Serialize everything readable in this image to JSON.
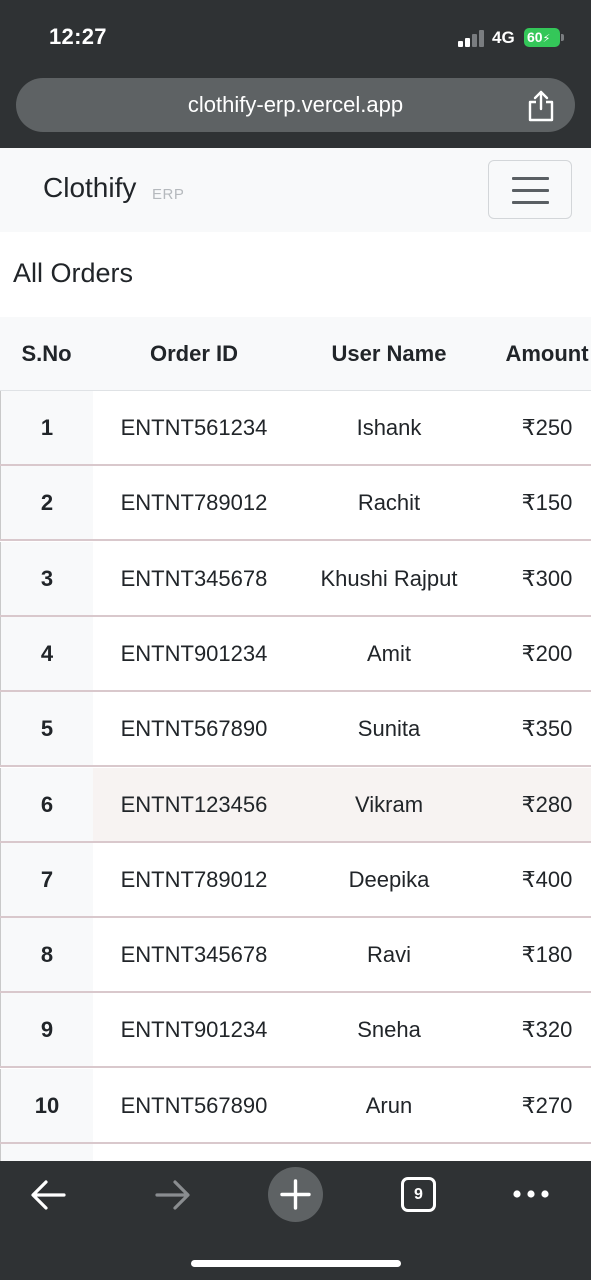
{
  "status_bar": {
    "time": "12:27",
    "network": "4G",
    "battery": "60",
    "icons": [
      "signal-icon",
      "battery-charging-icon"
    ]
  },
  "browser": {
    "url": "clothify-erp.vercel.app",
    "tab_count": "9",
    "icons": [
      "share-icon",
      "back-arrow-icon",
      "forward-arrow-icon",
      "plus-icon",
      "tabs-icon",
      "more-dots-icon"
    ]
  },
  "navbar": {
    "brand": "Clothify",
    "brand_sub": "ERP",
    "toggler_icon": "hamburger-menu-icon"
  },
  "page": {
    "title": "All Orders"
  },
  "table": {
    "headers": {
      "sno": "S.No",
      "order_id": "Order ID",
      "user_name": "User Name",
      "amount": "Amount"
    },
    "rows": [
      {
        "sno": "1",
        "order_id": "ENTNT561234",
        "user_name": "Ishank",
        "amount": "₹250"
      },
      {
        "sno": "2",
        "order_id": "ENTNT789012",
        "user_name": "Rachit",
        "amount": "₹150"
      },
      {
        "sno": "3",
        "order_id": "ENTNT345678",
        "user_name": "Khushi Rajput",
        "amount": "₹300"
      },
      {
        "sno": "4",
        "order_id": "ENTNT901234",
        "user_name": "Amit",
        "amount": "₹200"
      },
      {
        "sno": "5",
        "order_id": "ENTNT567890",
        "user_name": "Sunita",
        "amount": "₹350"
      },
      {
        "sno": "6",
        "order_id": "ENTNT123456",
        "user_name": "Vikram",
        "amount": "₹280"
      },
      {
        "sno": "7",
        "order_id": "ENTNT789012",
        "user_name": "Deepika",
        "amount": "₹400"
      },
      {
        "sno": "8",
        "order_id": "ENTNT345678",
        "user_name": "Ravi",
        "amount": "₹180"
      },
      {
        "sno": "9",
        "order_id": "ENTNT901234",
        "user_name": "Sneha",
        "amount": "₹320"
      },
      {
        "sno": "10",
        "order_id": "ENTNT567890",
        "user_name": "Arun",
        "amount": "₹270"
      }
    ],
    "highlighted_row": "6"
  },
  "colors": {
    "browser_chrome": "#2f3234",
    "url_pill": "#5e6264",
    "navbar_bg": "#f8f9fa",
    "row_border": "#d9c8cc",
    "highlight_row": "#f7f3f2",
    "battery_green": "#34c759"
  }
}
